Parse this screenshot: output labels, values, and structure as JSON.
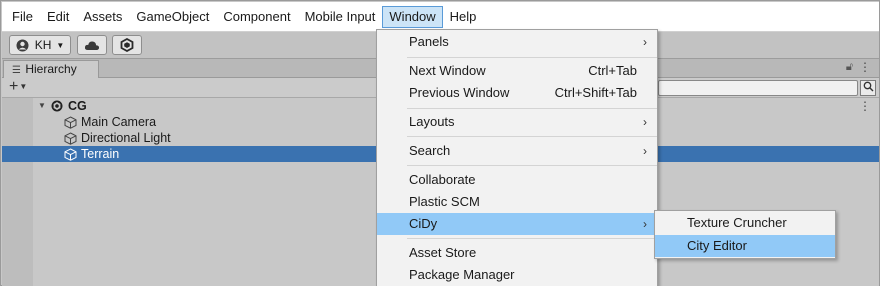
{
  "menubar": {
    "items": [
      "File",
      "Edit",
      "Assets",
      "GameObject",
      "Component",
      "Mobile Input",
      "Window",
      "Help"
    ],
    "active": "Window"
  },
  "toolbar": {
    "account_label": "KH",
    "icons": [
      "user-icon",
      "chevron-down-icon",
      "cloud-icon",
      "collab-icon"
    ]
  },
  "hierarchy": {
    "tab_label": "Hierarchy",
    "add_label": "+",
    "scene": "CG",
    "objects": [
      "Main Camera",
      "Directional Light",
      "Terrain"
    ],
    "selected": "Terrain"
  },
  "window_menu": {
    "items": [
      {
        "label": "Panels",
        "shortcut": "",
        "submenu": true
      },
      {
        "label": "Next Window",
        "shortcut": "Ctrl+Tab",
        "submenu": false
      },
      {
        "label": "Previous Window",
        "shortcut": "Ctrl+Shift+Tab",
        "submenu": false
      },
      {
        "label": "Layouts",
        "shortcut": "",
        "submenu": true
      },
      {
        "label": "Search",
        "shortcut": "",
        "submenu": true
      },
      {
        "label": "Collaborate",
        "shortcut": "",
        "submenu": false
      },
      {
        "label": "Plastic SCM",
        "shortcut": "",
        "submenu": false
      },
      {
        "label": "CiDy",
        "shortcut": "",
        "submenu": true
      },
      {
        "label": "Asset Store",
        "shortcut": "",
        "submenu": false
      },
      {
        "label": "Package Manager",
        "shortcut": "",
        "submenu": false
      }
    ],
    "highlighted": "CiDy"
  },
  "cidy_submenu": {
    "items": [
      "Texture Cruncher",
      "City Editor"
    ],
    "highlighted": "City Editor"
  },
  "colors": {
    "selection_blue": "#3a72b0",
    "menu_highlight": "#91c9f7",
    "menubar_active": "#cce4f7"
  }
}
